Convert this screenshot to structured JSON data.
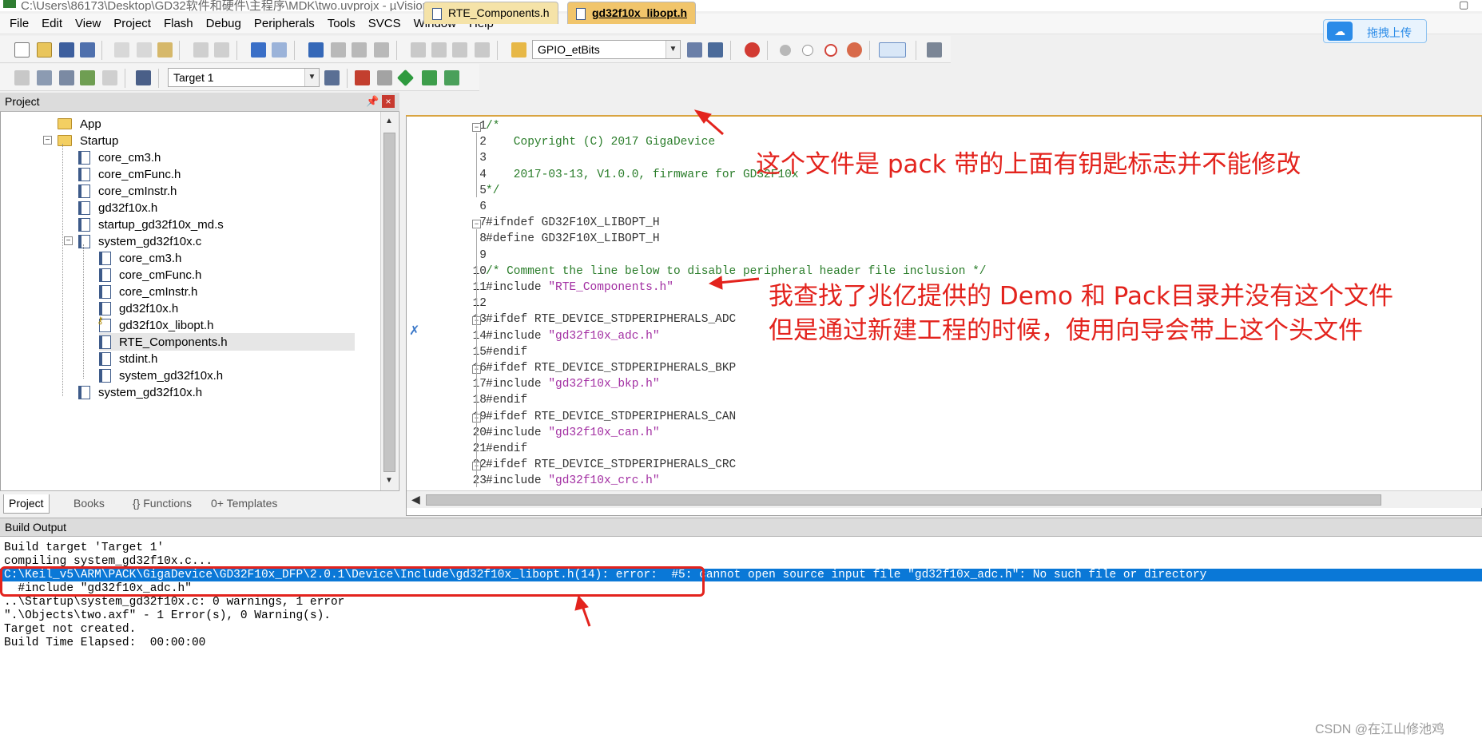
{
  "window": {
    "title": "C:\\Users\\86173\\Desktop\\GD32软件和硬件\\主程序\\MDK\\two.uvprojx - µVision"
  },
  "menu": [
    "File",
    "Edit",
    "View",
    "Project",
    "Flash",
    "Debug",
    "Peripherals",
    "Tools",
    "SVCS",
    "Window",
    "Help"
  ],
  "toolbar": {
    "function_combo": "GPIO_etBits",
    "target_combo": "Target 1"
  },
  "upload_widget": {
    "label": "拖拽上传"
  },
  "project_panel": {
    "title": "Project",
    "pin_glyph": "📌",
    "close_glyph": "×",
    "tree": [
      {
        "label": "App",
        "kind": "folder",
        "depth": 1
      },
      {
        "label": "Startup",
        "kind": "folder",
        "depth": 1,
        "expanded": true
      },
      {
        "label": "core_cm3.h",
        "kind": "file",
        "depth": 2
      },
      {
        "label": "core_cmFunc.h",
        "kind": "file",
        "depth": 2
      },
      {
        "label": "core_cmInstr.h",
        "kind": "file",
        "depth": 2
      },
      {
        "label": "gd32f10x.h",
        "kind": "file",
        "depth": 2
      },
      {
        "label": "startup_gd32f10x_md.s",
        "kind": "file",
        "depth": 2
      },
      {
        "label": "system_gd32f10x.c",
        "kind": "file",
        "depth": 2,
        "expanded": true
      },
      {
        "label": "core_cm3.h",
        "kind": "file",
        "depth": 3
      },
      {
        "label": "core_cmFunc.h",
        "kind": "file",
        "depth": 3
      },
      {
        "label": "core_cmInstr.h",
        "kind": "file",
        "depth": 3
      },
      {
        "label": "gd32f10x.h",
        "kind": "file",
        "depth": 3
      },
      {
        "label": "gd32f10x_libopt.h",
        "kind": "key",
        "depth": 3
      },
      {
        "label": "RTE_Components.h",
        "kind": "file",
        "depth": 3,
        "selected": true
      },
      {
        "label": "stdint.h",
        "kind": "file",
        "depth": 3
      },
      {
        "label": "system_gd32f10x.h",
        "kind": "file",
        "depth": 3
      },
      {
        "label": "system_gd32f10x.h",
        "kind": "file",
        "depth": 2
      }
    ],
    "tabs": [
      "Project",
      "Books",
      "{} Functions",
      "0+ Templates"
    ]
  },
  "editor": {
    "tabs": [
      "RTE_Components.h",
      "gd32f10x_libopt.h"
    ],
    "active_tab": "gd32f10x_libopt.h",
    "lines": [
      {
        "n": "1",
        "t": "/*",
        "c": "comment"
      },
      {
        "n": "2",
        "t": "    Copyright (C) 2017 GigaDevice",
        "c": "comment"
      },
      {
        "n": "3",
        "t": "",
        "c": "comment"
      },
      {
        "n": "4",
        "t": "    2017-03-13, V1.0.0, firmware for GD32F10x",
        "c": "comment"
      },
      {
        "n": "5",
        "t": "*/",
        "c": "comment"
      },
      {
        "n": "6",
        "t": "",
        "c": "pre"
      },
      {
        "n": "7",
        "t": "#ifndef GD32F10X_LIBOPT_H",
        "c": "pre"
      },
      {
        "n": "8",
        "t": "#define GD32F10X_LIBOPT_H",
        "c": "pre"
      },
      {
        "n": "9",
        "t": "",
        "c": "pre"
      },
      {
        "n": "10",
        "t": "/* Comment the line below to disable peripheral header file inclusion */",
        "c": "comment"
      },
      {
        "n": "11",
        "t": "#include \"RTE_Components.h\"",
        "c": "pre"
      },
      {
        "n": "12",
        "t": "",
        "c": "pre"
      },
      {
        "n": "13",
        "t": "#ifdef RTE_DEVICE_STDPERIPHERALS_ADC",
        "c": "pre"
      },
      {
        "n": "14",
        "t": "#include \"gd32f10x_adc.h\"",
        "c": "pre"
      },
      {
        "n": "15",
        "t": "#endif",
        "c": "pre"
      },
      {
        "n": "16",
        "t": "#ifdef RTE_DEVICE_STDPERIPHERALS_BKP",
        "c": "pre"
      },
      {
        "n": "17",
        "t": "#include \"gd32f10x_bkp.h\"",
        "c": "pre"
      },
      {
        "n": "18",
        "t": "#endif",
        "c": "pre"
      },
      {
        "n": "19",
        "t": "#ifdef RTE_DEVICE_STDPERIPHERALS_CAN",
        "c": "pre"
      },
      {
        "n": "20",
        "t": "#include \"gd32f10x_can.h\"",
        "c": "pre"
      },
      {
        "n": "21",
        "t": "#endif",
        "c": "pre"
      },
      {
        "n": "22",
        "t": "#ifdef RTE_DEVICE_STDPERIPHERALS_CRC",
        "c": "pre"
      },
      {
        "n": "23",
        "t": "#include \"gd32f10x_crc.h\"",
        "c": "pre"
      }
    ]
  },
  "build_output": {
    "title": "Build Output",
    "lines": [
      "Build target 'Target 1'",
      "compiling system_gd32f10x.c...",
      "C:\\Keil_v5\\ARM\\PACK\\GigaDevice\\GD32F10x_DFP\\2.0.1\\Device\\Include\\gd32f10x_libopt.h(14): error:  #5: cannot open source input file \"gd32f10x_adc.h\": No such file or directory",
      "  #include \"gd32f10x_adc.h\"",
      "..\\Startup\\system_gd32f10x.c: 0 warnings, 1 error",
      "\".\\Objects\\two.axf\" - 1 Error(s), 0 Warning(s).",
      "Target not created.",
      "Build Time Elapsed:  00:00:00"
    ],
    "highlight_index": 2
  },
  "annotations": {
    "note1": "这个文件是 pack 带的上面有钥匙标志并不能修改",
    "note2": "我查找了兆亿提供的 Demo 和 Pack目录并没有这个文件",
    "note3": "但是通过新建工程的时候，使用向导会带上这个头文件"
  },
  "watermark": "CSDN @在江山修池鸡",
  "colors": {
    "annotation": "#e3231d",
    "selection": "#0a78d7",
    "comment": "#2a7d2a",
    "string": "#a22ea2",
    "active_tab": "#f1c56b"
  },
  "icons": [
    "new-file-icon",
    "open-icon",
    "save-icon",
    "save-all-icon",
    "cut-icon",
    "copy-icon",
    "paste-icon",
    "undo-icon",
    "redo-icon",
    "back-icon",
    "forward-icon",
    "bookmark-icon",
    "indent-icon",
    "outdent-icon",
    "comment-icon",
    "find-icon",
    "debug-icon",
    "breakpoint-icon",
    "configure-icon",
    "build-icon",
    "rebuild-icon",
    "load-icon",
    "translate-icon",
    "options-icon",
    "manage-components-icon"
  ]
}
